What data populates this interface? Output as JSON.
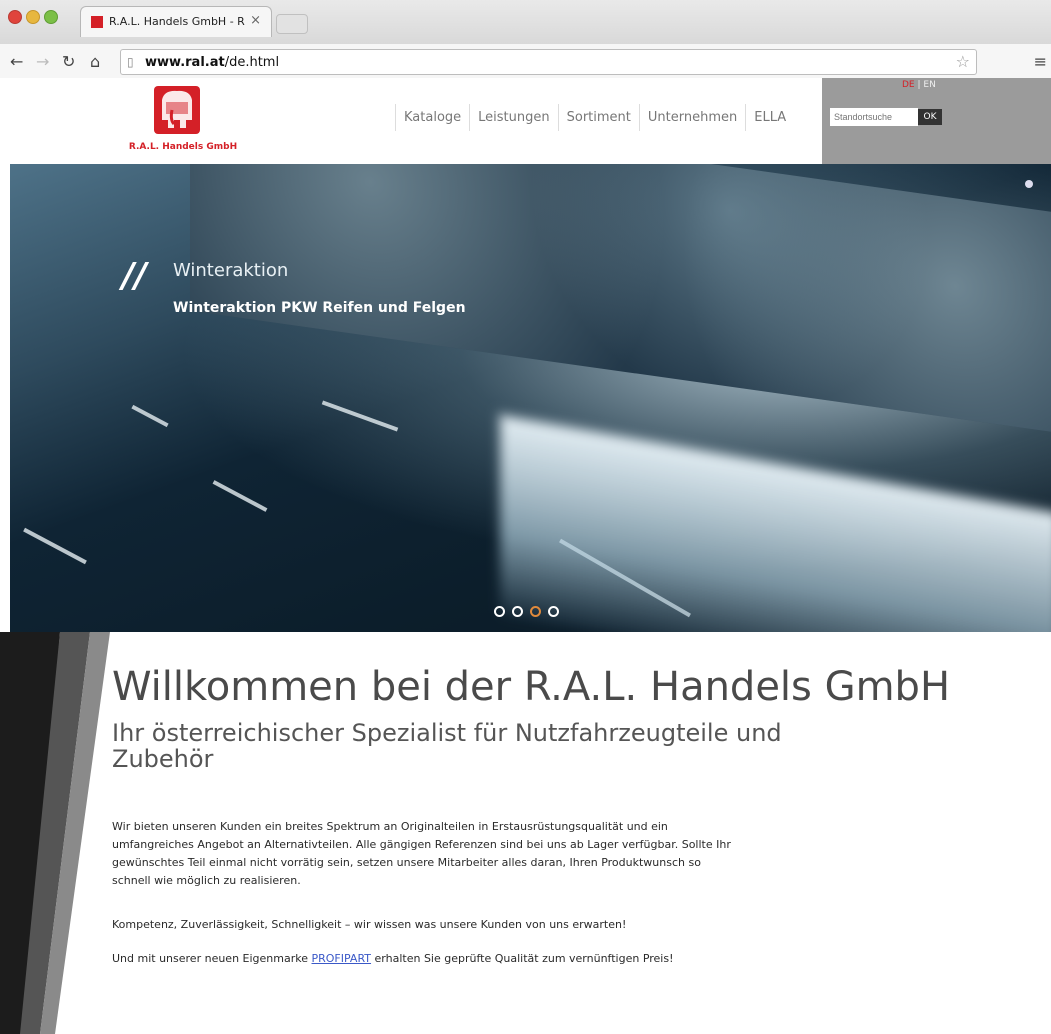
{
  "browser": {
    "tab_title": "R.A.L. Handels GmbH - R",
    "tab_close": "×",
    "url_host": "www.ral.at",
    "url_path": "/de.html"
  },
  "site": {
    "logo_text": "R.A.L. Handels GmbH",
    "nav": [
      "Kataloge",
      "Leistungen",
      "Sortiment",
      "Unternehmen",
      "ELLA"
    ],
    "lang": {
      "de": "DE",
      "sep": " | ",
      "en": "EN"
    },
    "search_placeholder": "Standortsuche",
    "ok_label": "OK"
  },
  "hero": {
    "title": "Winteraktion",
    "subtitle": "Winteraktion PKW Reifen und Felgen",
    "active_slide": 3,
    "slide_count": 4
  },
  "content": {
    "heading": "Willkommen bei der R.A.L. Handels GmbH",
    "tagline": "Ihr österreichischer Spezialist für Nutzfahrzeugteile und Zubehör",
    "p1": "Wir bieten unseren Kunden ein breites Spektrum an Originalteilen in Erstausrüstungsqualität und ein umfangreiches Angebot an Alternativteilen. Alle gängigen Referenzen sind bei uns ab Lager verfügbar. Sollte Ihr gewünschtes Teil einmal nicht vorrätig sein, setzen unsere Mitarbeiter alles daran, Ihren Produktwunsch so schnell wie möglich zu realisieren.",
    "p2": "Kompetenz, Zuverlässigkeit, Schnelligkeit – wir wissen was unsere Kunden von uns erwarten!",
    "p3_before": "Und mit unserer neuen Eigenmarke ",
    "p3_link": "PROFIPART",
    "p3_after": " erhalten Sie geprüfte Qualität zum vernünftigen Preis!"
  },
  "colors": {
    "brand_red": "#d42027",
    "accent_orange": "#e08a3c",
    "link_blue": "#3b59c8"
  }
}
